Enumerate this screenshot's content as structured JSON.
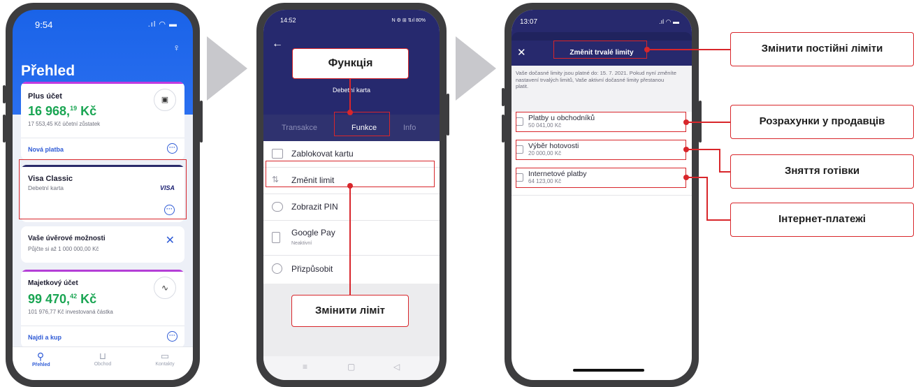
{
  "screen1": {
    "time": "9:54",
    "signal_icon": "signal-wifi-battery-icon",
    "title": "Přehled",
    "plus_account": {
      "name": "Plus účet",
      "balance_main": "16 968,",
      "balance_cents": "19",
      "currency": "Kč",
      "accounting_balance": "17 553,45 Kč účetní zůstatek",
      "action": "Nová platba"
    },
    "visa": {
      "name": "Visa Classic",
      "type": "Debetní karta",
      "brand": "VISA"
    },
    "credit": {
      "title": "Vaše úvěrové možnosti",
      "subtitle": "Půjčte si až 1 000 000,00 Kč"
    },
    "investment": {
      "name": "Majetkový účet",
      "balance_main": "99 470,",
      "balance_cents": "42",
      "currency": "Kč",
      "invested": "101 976,77 Kč investovaná částka",
      "action": "Najdi a kup"
    },
    "tabs": [
      "Přehled",
      "Obchod",
      "Kontakty"
    ],
    "accent": "#1f66ea",
    "green": "#1aa553"
  },
  "screen2": {
    "time": "14:52",
    "status_right": "N ⚙ ⊞ ⇅ıl 80%",
    "subtitle": "Debetní karta",
    "tabs": [
      "Transakce",
      "Funkce",
      "Info"
    ],
    "menu": [
      {
        "label": "Zablokovat kartu",
        "icon": "card-block-icon"
      },
      {
        "label": "Změnit limit",
        "icon": "arrows-updown-icon"
      },
      {
        "label": "Zobrazit PIN",
        "icon": "pin-dots-icon"
      },
      {
        "label": "Google Pay",
        "icon": "phone-nfc-icon",
        "sub": "Neaktivní"
      },
      {
        "label": "Přizpůsobit",
        "icon": "palette-icon"
      }
    ],
    "nav": [
      "≡",
      "▢",
      "◁"
    ]
  },
  "screen3": {
    "time": "13:07",
    "title": "Změnit trvalé limity",
    "notice": "Vaše dočasné limity jsou platné do: 15. 7. 2021. Pokud nyní změníte nastavení trvalých limitů, Vaše aktivní dočasné limity přestanou platit.",
    "limits": [
      {
        "name": "Platby u obchodníků",
        "amount": "50 041,00 Kč"
      },
      {
        "name": "Výběr hotovosti",
        "amount": "20 000,00 Kč"
      },
      {
        "name": "Internetové platby",
        "amount": "64 123,00 Kč"
      }
    ]
  },
  "annotations": {
    "function": "Функція",
    "change_limit": "Змінити ліміт",
    "change_permanent": "Змінити постійні ліміти",
    "merchants": "Розрахунки у продавців",
    "cash": "Зняття готівки",
    "internet": "Інтернет-платежі",
    "color": "#d8262b"
  }
}
